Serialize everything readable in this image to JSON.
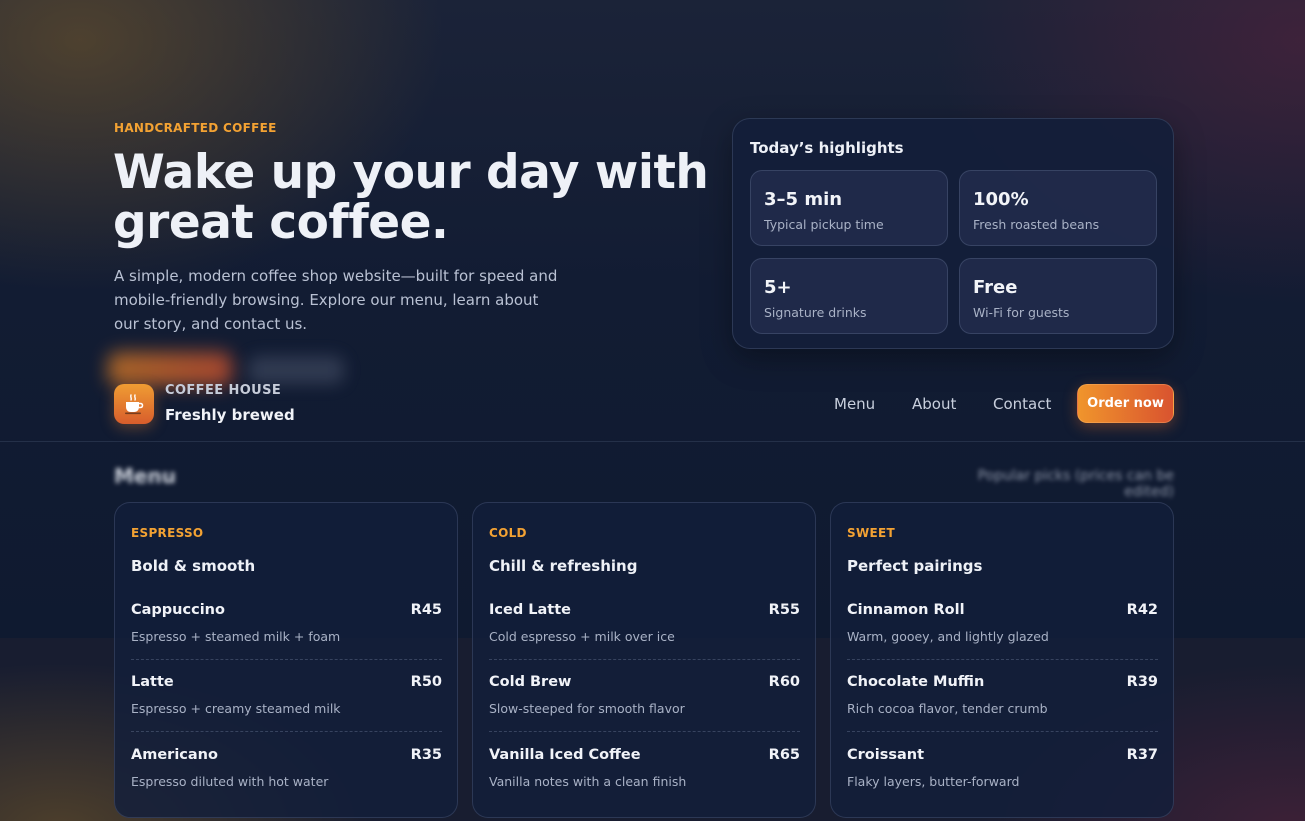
{
  "hero": {
    "eyebrow": "HANDCRAFTED COFFEE",
    "title": "Wake up your day with great coffee.",
    "description": "A simple, modern coffee shop website—built for speed and mobile-friendly browsing. Explore our menu, learn about our story, and contact us."
  },
  "highlights": {
    "title": "Today’s highlights",
    "stats": [
      {
        "value": "3–5 min",
        "label": "Typical pickup time"
      },
      {
        "value": "100%",
        "label": "Fresh roasted beans"
      },
      {
        "value": "5+",
        "label": "Signature drinks"
      },
      {
        "value": "Free",
        "label": "Wi-Fi for guests"
      }
    ]
  },
  "header": {
    "brand_name": "COFFEE HOUSE",
    "brand_tagline": "Freshly brewed",
    "logo_icon": "coffee-cup-icon",
    "nav": [
      "Menu",
      "About",
      "Contact"
    ],
    "order_label": "Order now"
  },
  "menu": {
    "title": "Menu",
    "note": "Popular picks (prices can be edited)",
    "categories": [
      {
        "kicker": "ESPRESSO",
        "title": "Bold & smooth",
        "items": [
          {
            "name": "Cappuccino",
            "price": "R45",
            "desc": "Espresso + steamed milk + foam"
          },
          {
            "name": "Latte",
            "price": "R50",
            "desc": "Espresso + creamy steamed milk"
          },
          {
            "name": "Americano",
            "price": "R35",
            "desc": "Espresso diluted with hot water"
          }
        ]
      },
      {
        "kicker": "COLD",
        "title": "Chill & refreshing",
        "items": [
          {
            "name": "Iced Latte",
            "price": "R55",
            "desc": "Cold espresso + milk over ice"
          },
          {
            "name": "Cold Brew",
            "price": "R60",
            "desc": "Slow-steeped for smooth flavor"
          },
          {
            "name": "Vanilla Iced Coffee",
            "price": "R65",
            "desc": "Vanilla notes with a clean finish"
          }
        ]
      },
      {
        "kicker": "SWEET",
        "title": "Perfect pairings",
        "items": [
          {
            "name": "Cinnamon Roll",
            "price": "R42",
            "desc": "Warm, gooey, and lightly glazed"
          },
          {
            "name": "Chocolate Muffin",
            "price": "R39",
            "desc": "Rich cocoa flavor, tender crumb"
          },
          {
            "name": "Croissant",
            "price": "R37",
            "desc": "Flaky layers, butter-forward"
          }
        ]
      }
    ]
  },
  "colors": {
    "accent": "#f3a233",
    "button_gradient_start": "#f0952c",
    "button_gradient_end": "#d9532f",
    "background": "#0f1a30"
  }
}
